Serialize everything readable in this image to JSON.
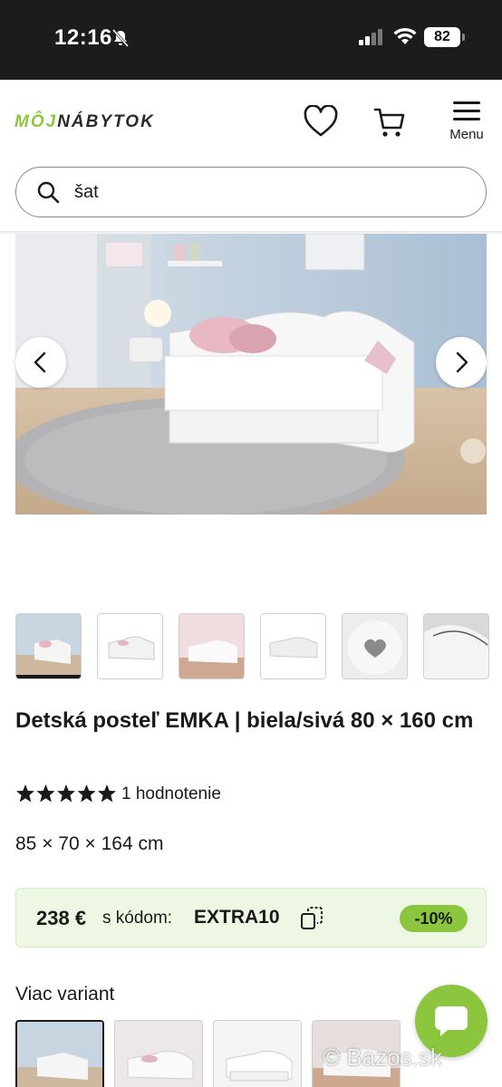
{
  "status_bar": {
    "time": "12:16",
    "battery": "82"
  },
  "header": {
    "logo_part1": "MÔJ",
    "logo_part2": "NÁBYTOK",
    "menu_label": "Menu"
  },
  "search": {
    "value": "šat"
  },
  "product": {
    "title": "Detská posteľ EMKA | biela/sivá 80 × 160 cm",
    "rating": 5,
    "rating_count_label": "1 hodnotenie",
    "dimensions": "85 × 70 × 164 cm"
  },
  "promo": {
    "price": "238 €",
    "code_label": "s kódom:",
    "code": "EXTRA10",
    "discount": "-10%"
  },
  "variants": {
    "title": "Viac variant"
  },
  "watermark": "© Bazos.sk",
  "colors": {
    "brand_green": "#8cc63f",
    "promo_bg": "#eef7e4",
    "dark": "#1a1a1a"
  }
}
